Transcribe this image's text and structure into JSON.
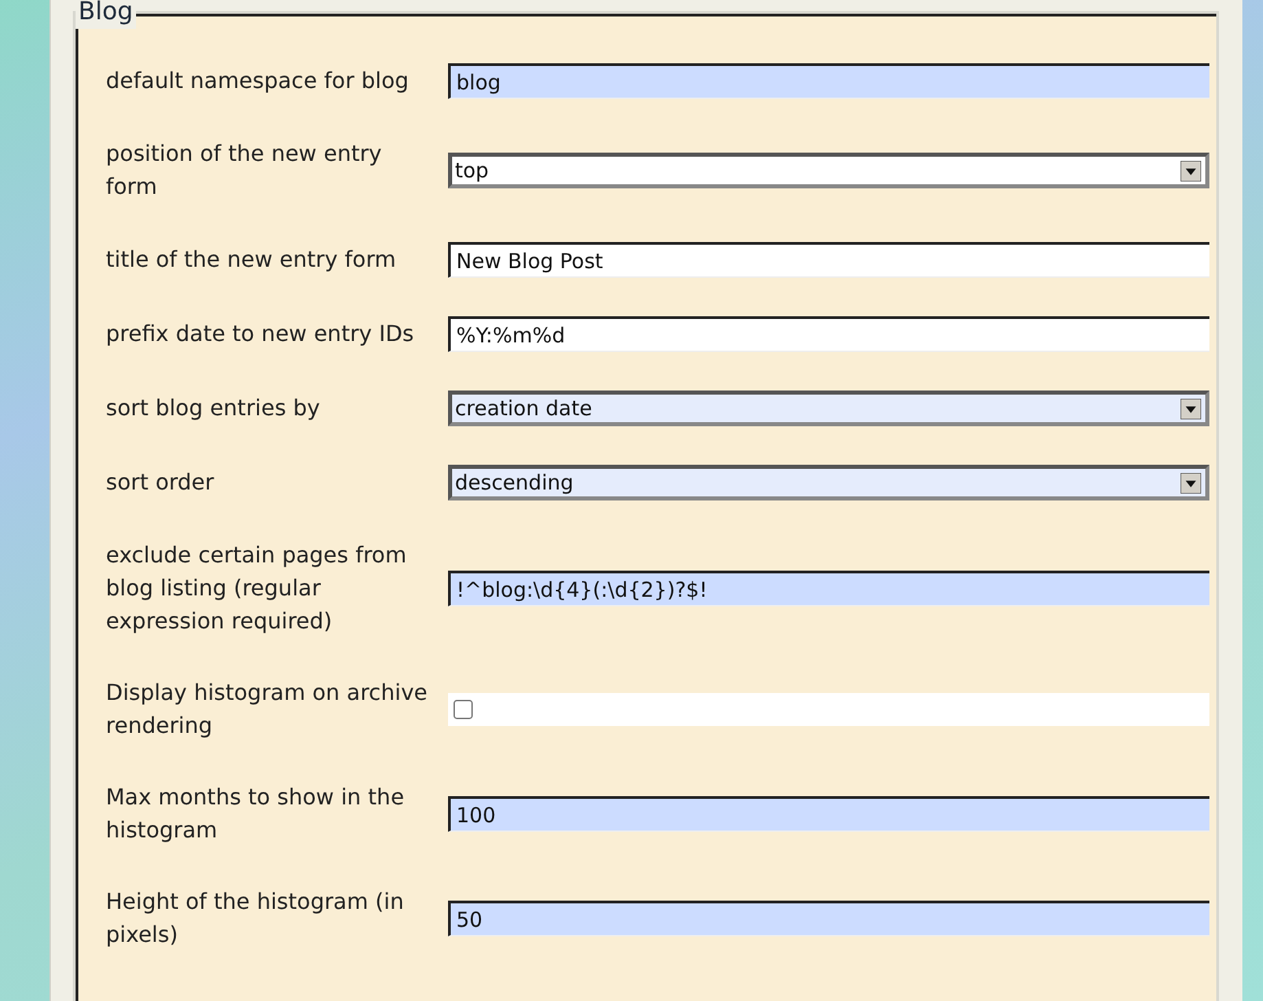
{
  "section": {
    "title": "Blog"
  },
  "settings": [
    {
      "label": "default namespace for blog",
      "kind": "text",
      "value": "blog",
      "highlighted": true
    },
    {
      "label": "position of the new entry form",
      "kind": "select",
      "value": "top",
      "highlighted": false
    },
    {
      "label": "title of the new entry form",
      "kind": "text",
      "value": "New Blog Post",
      "highlighted": false
    },
    {
      "label": "prefix date to new entry IDs",
      "kind": "text",
      "value": "%Y:%m%d",
      "highlighted": false
    },
    {
      "label": "sort blog entries by",
      "kind": "select",
      "value": "creation date",
      "highlighted": true
    },
    {
      "label": "sort order",
      "kind": "select",
      "value": "descending",
      "highlighted": true
    },
    {
      "label": "exclude certain pages from blog listing (regular expression required)",
      "kind": "text",
      "value": "!^blog:\\d{4}(:\\d{2})?$!",
      "highlighted": true
    },
    {
      "label": "Display histogram on archive rendering",
      "kind": "checkbox",
      "checked": false
    },
    {
      "label": "Max months to show in the histogram",
      "kind": "text",
      "value": "100",
      "highlighted": true
    },
    {
      "label": "Height of the histogram (in pixels)",
      "kind": "text",
      "value": "50",
      "highlighted": true
    }
  ]
}
